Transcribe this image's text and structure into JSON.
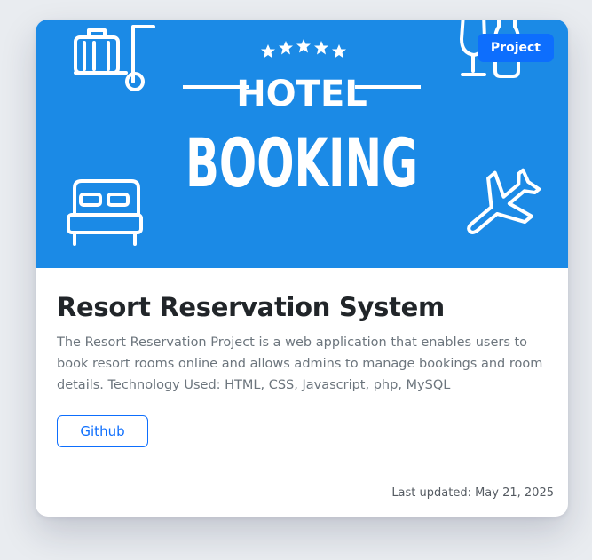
{
  "card": {
    "badge": "Project",
    "banner": {
      "line1": "HOTEL",
      "line2": "BOOKING",
      "stars": 5,
      "background_color": "#1b8ae6",
      "icons": [
        "luggage-cart-icon",
        "wine-glass-icon",
        "bottle-icon",
        "bed-icon",
        "airplane-icon",
        "star-icon"
      ]
    },
    "title": "Resort Reservation System",
    "description": "The Resort Reservation Project is a web application that enables users to book resort rooms online and allows admins to manage bookings and room details. Technology Used: HTML, CSS, Javascript, php, MySQL",
    "github_label": "Github",
    "last_updated": "Last updated: May 21, 2025"
  },
  "colors": {
    "accent": "#0d6efd",
    "title": "#212529",
    "text": "#6c757d",
    "page_background": "#e9ecf0"
  }
}
